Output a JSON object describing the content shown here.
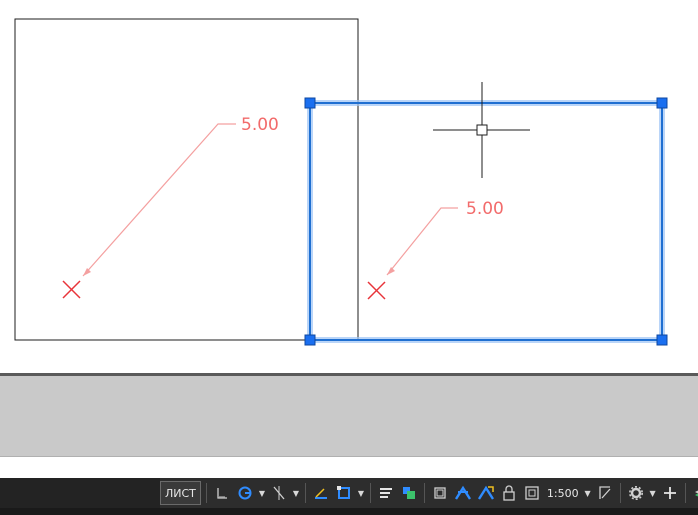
{
  "drawing": {
    "dimension_left": "5.00",
    "dimension_right": "5.00",
    "colors": {
      "line": "#1e1e1e",
      "dimension": "#f26b6b",
      "marker": "#e8343a",
      "selection": "#1f6fd1",
      "grip": "#1a6ff0"
    }
  },
  "statusbar": {
    "layout_label": "ЛИСТ",
    "scale": "1:500",
    "trailing_count": "3",
    "icons": [
      "grid-snap-icon",
      "ortho-icon",
      "polar-tracking-icon",
      "osnap-tracking-icon",
      "dynamic-ucs-icon",
      "object-snap-icon",
      "lineweight-icon",
      "transparency-icon",
      "selection-cycling-icon",
      "annotation-visibility-icon",
      "auto-scale-icon",
      "lock-ui-icon",
      "isolate-objects-icon",
      "viewport-scale-lock-icon",
      "workspace-gear-icon",
      "plus-icon",
      "layers-icon"
    ]
  }
}
